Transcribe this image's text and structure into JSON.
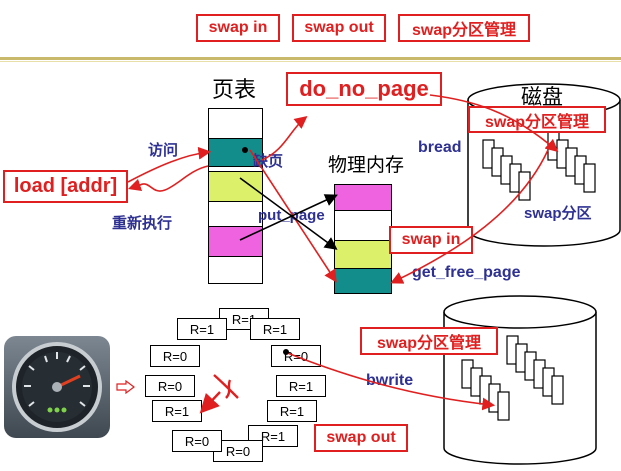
{
  "header": {
    "swap_in": "swap in",
    "swap_out": "swap out",
    "swap_partition_mgmt": "swap分区管理"
  },
  "labels": {
    "page_table": "页表",
    "do_no_page": "do_no_page",
    "disk": "磁盘",
    "swap_partition_mgmt_top": "swap分区管理",
    "bread": "bread",
    "access": "访问",
    "missing_page": "缺页",
    "physical_memory": "物理内存",
    "load_addr": "load [addr]",
    "re_execute": "重新执行",
    "put_page": "put_page",
    "swap_partition": "swap分区",
    "swap_in_mid": "swap in",
    "get_free_page": "get_free_page",
    "swap_partition_mgmt_bottom": "swap分区管理",
    "bwrite": "bwrite",
    "swap_out_bottom": "swap out"
  },
  "clock_entries": [
    "R=1",
    "R=1",
    "R=0",
    "R=1",
    "R=1",
    "R=1",
    "R=0",
    "R=0",
    "R=1",
    "R=0",
    "R=0",
    "R=1"
  ],
  "colors": {
    "red": "#e02020",
    "blue_text": "#2e3192",
    "teal": "#138c8c",
    "lime": "#ddf06a",
    "magenta": "#ef62e0",
    "olive_rule": "#c9b96a"
  },
  "icons": {
    "speedometer": "gauge-icon",
    "arrow": "hollow-right-arrow-icon"
  }
}
